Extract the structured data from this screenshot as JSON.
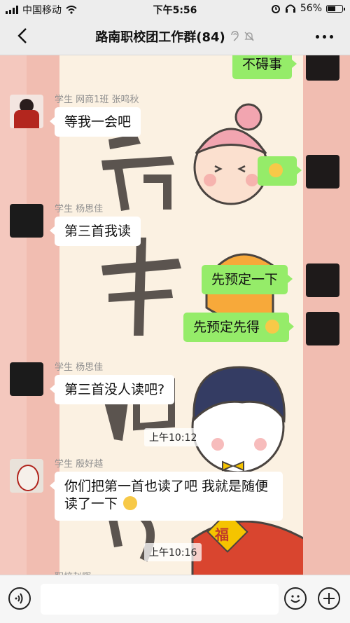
{
  "status_bar": {
    "carrier": "中国移动",
    "time": "下午5:56",
    "battery": "56%",
    "battery_level": 0.56
  },
  "nav": {
    "title": "路南职校团工作群(84)",
    "title_icons": [
      "ear-icon",
      "bell-off-icon"
    ]
  },
  "messages": [
    {
      "side": "right",
      "text": "不碍事"
    },
    {
      "side": "left",
      "sender": "学生  网商1班 张鸣秋",
      "text": "等我一会吧"
    },
    {
      "side": "right",
      "text": "",
      "emoji": "smirk-emoji"
    },
    {
      "side": "left",
      "sender": "学生  杨思佳",
      "text": "第三首我读"
    },
    {
      "side": "right",
      "text": "先预定一下"
    },
    {
      "side": "right",
      "text": "先预定先得",
      "emoji": "cat-emoji"
    },
    {
      "side": "left",
      "sender": "学生  杨思佳",
      "text": "第三首没人读吧?"
    },
    {
      "time": "上午10:12"
    },
    {
      "side": "left",
      "sender": "学生  殷好越",
      "text": "你们把第一首也读了吧 我就是随便读了一下",
      "emoji": "laugh-cry-emoji"
    },
    {
      "time": "上午10:16"
    },
    {
      "side": "left",
      "sender": "职校赵辉",
      "text": ""
    }
  ],
  "background_art": {
    "calligraphy": [
      "萬",
      "事",
      "如",
      "意"
    ],
    "blessing": "福"
  },
  "input_bar": {
    "placeholder": ""
  },
  "colors": {
    "outgoing_bubble": "#95ec69",
    "incoming_bubble": "#ffffff",
    "chat_background": "#f1bdb1",
    "panel": "#fbf1e2"
  }
}
